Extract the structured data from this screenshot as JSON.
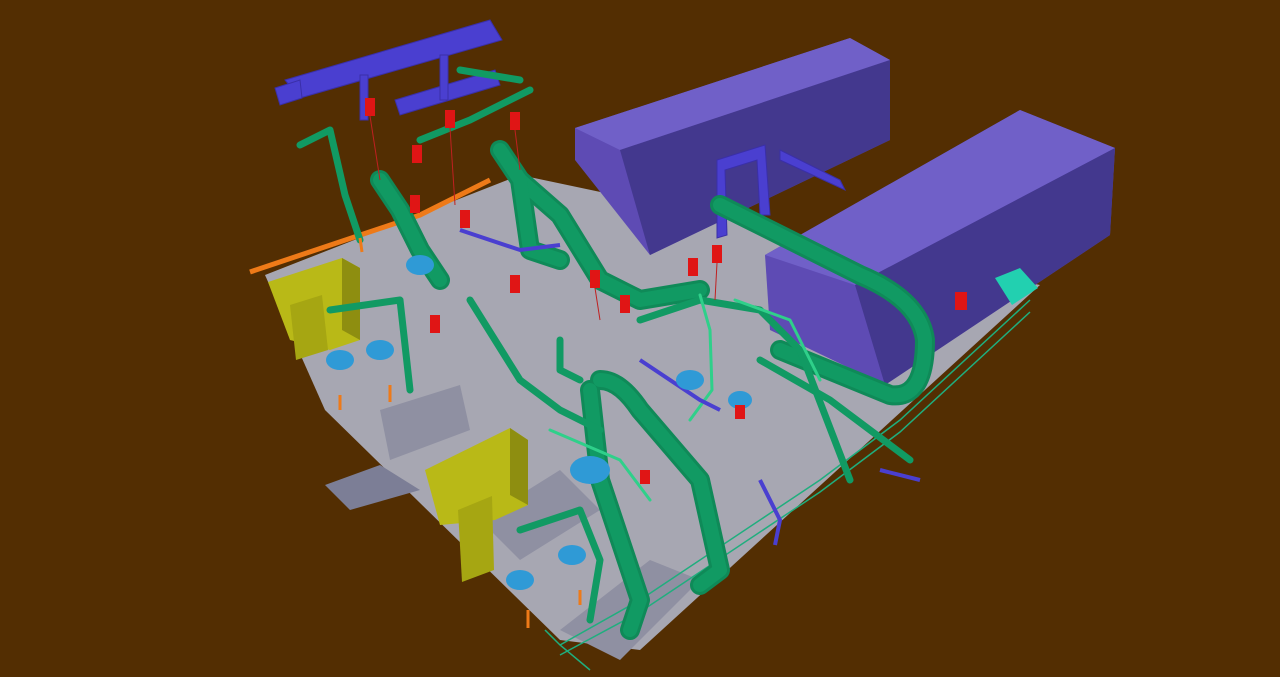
{
  "scene": {
    "colors": {
      "background": "#532e02",
      "floor": "#a7a7b2",
      "floor_dark": "#7c7e96",
      "building": "#5e4bb4",
      "building_side": "#43388e",
      "building_top": "#7060c8",
      "pipe": "#119a63",
      "pipe_highlight": "#2fd08a",
      "structure": "#4a3fd0",
      "tank": "#b9b917",
      "tank_side": "#8e8e10",
      "valve": "#e01515",
      "pump": "#2f9ad6",
      "railing": "#1fae7e",
      "panel": "#22d0b0",
      "conduit": "#ee7a18"
    }
  }
}
